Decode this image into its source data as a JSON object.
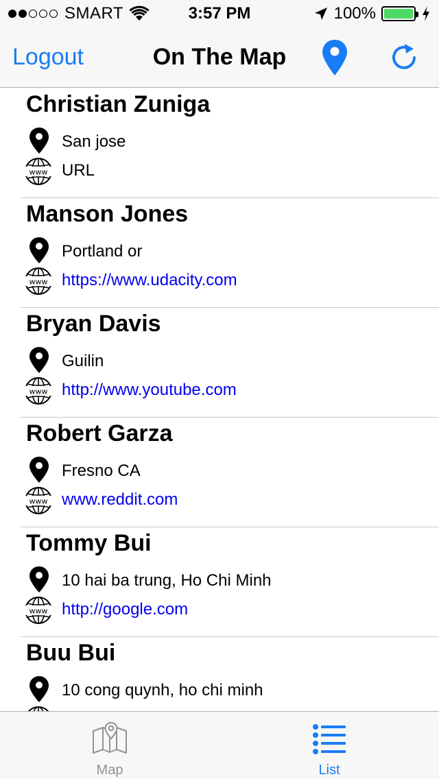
{
  "status_bar": {
    "carrier": "SMART",
    "time": "3:57 PM",
    "battery_percent": "100%",
    "signal_bars_filled": 2,
    "signal_bars_total": 5,
    "battery_color": "#4cd964"
  },
  "nav": {
    "logout_label": "Logout",
    "title": "On The Map",
    "pin_icon": "map-pin-icon",
    "refresh_icon": "refresh-icon",
    "accent_color": "#1a7cf4"
  },
  "students": [
    {
      "name": "Christian Zuniga",
      "location": "San jose",
      "url": "URL",
      "url_is_link": false
    },
    {
      "name": "Manson Jones",
      "location": "Portland or",
      "url": "https://www.udacity.com",
      "url_is_link": true
    },
    {
      "name": "Bryan Davis",
      "location": "Guilin",
      "url": "http://www.youtube.com",
      "url_is_link": true
    },
    {
      "name": "Robert Garza",
      "location": "Fresno CA",
      "url": "www.reddit.com",
      "url_is_link": true
    },
    {
      "name": "Tommy Bui",
      "location": "10 hai ba trung, Ho Chi Minh",
      "url": "http://google.com",
      "url_is_link": true
    },
    {
      "name": "Buu Bui",
      "location": "10 cong quynh, ho chi minh",
      "url": "",
      "url_is_link": true
    }
  ],
  "tab_bar": {
    "tabs": [
      {
        "label": "Map",
        "icon": "map-icon",
        "selected": false
      },
      {
        "label": "List",
        "icon": "list-icon",
        "selected": true
      }
    ]
  }
}
